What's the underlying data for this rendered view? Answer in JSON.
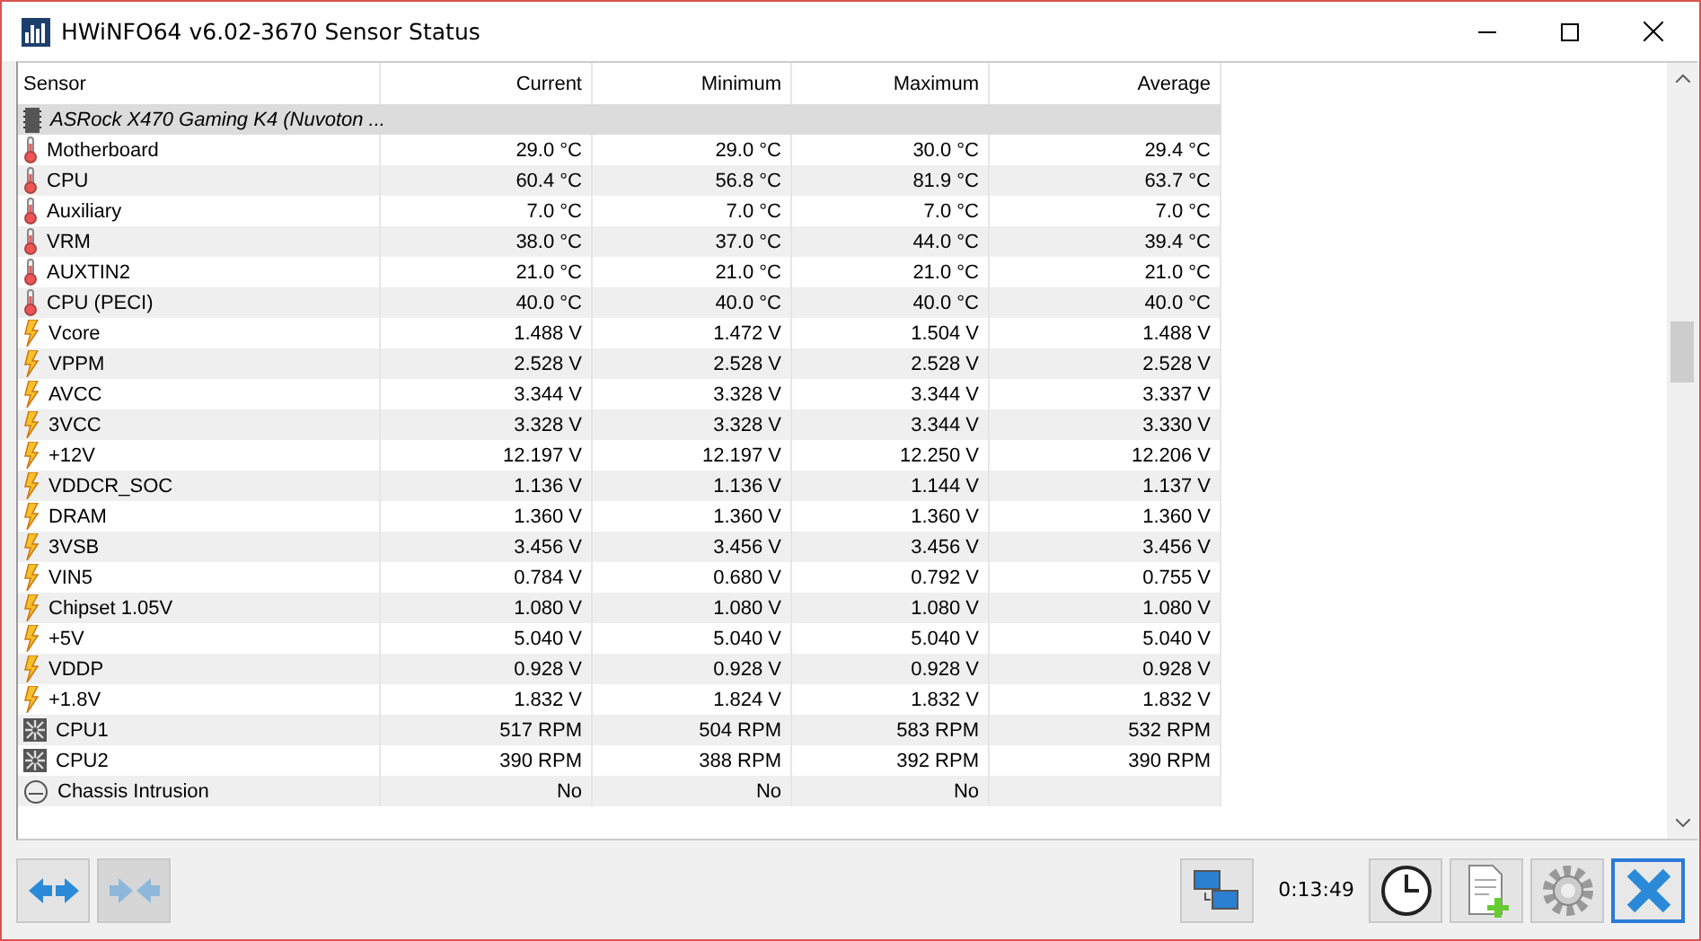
{
  "window": {
    "title": "HWiNFO64 v6.02-3670 Sensor Status"
  },
  "table": {
    "columns": [
      "Sensor",
      "Current",
      "Minimum",
      "Maximum",
      "Average"
    ],
    "rows": [
      {
        "kind": "group",
        "name": "ASRock X470 Gaming K4 (Nuvoton ...",
        "values": []
      },
      {
        "kind": "temperature",
        "name": "Motherboard",
        "values": [
          "29.0 °C",
          "29.0 °C",
          "30.0 °C",
          "29.4 °C"
        ]
      },
      {
        "kind": "temperature",
        "name": "CPU",
        "values": [
          "60.4 °C",
          "56.8 °C",
          "81.9 °C",
          "63.7 °C"
        ]
      },
      {
        "kind": "temperature",
        "name": "Auxiliary",
        "values": [
          "7.0 °C",
          "7.0 °C",
          "7.0 °C",
          "7.0 °C"
        ]
      },
      {
        "kind": "temperature",
        "name": "VRM",
        "values": [
          "38.0 °C",
          "37.0 °C",
          "44.0 °C",
          "39.4 °C"
        ]
      },
      {
        "kind": "temperature",
        "name": "AUXTIN2",
        "values": [
          "21.0 °C",
          "21.0 °C",
          "21.0 °C",
          "21.0 °C"
        ]
      },
      {
        "kind": "temperature",
        "name": "CPU (PECI)",
        "values": [
          "40.0 °C",
          "40.0 °C",
          "40.0 °C",
          "40.0 °C"
        ]
      },
      {
        "kind": "voltage",
        "name": "Vcore",
        "values": [
          "1.488 V",
          "1.472 V",
          "1.504 V",
          "1.488 V"
        ]
      },
      {
        "kind": "voltage",
        "name": "VPPM",
        "values": [
          "2.528 V",
          "2.528 V",
          "2.528 V",
          "2.528 V"
        ]
      },
      {
        "kind": "voltage",
        "name": "AVCC",
        "values": [
          "3.344 V",
          "3.328 V",
          "3.344 V",
          "3.337 V"
        ]
      },
      {
        "kind": "voltage",
        "name": "3VCC",
        "values": [
          "3.328 V",
          "3.328 V",
          "3.344 V",
          "3.330 V"
        ]
      },
      {
        "kind": "voltage",
        "name": "+12V",
        "values": [
          "12.197 V",
          "12.197 V",
          "12.250 V",
          "12.206 V"
        ]
      },
      {
        "kind": "voltage",
        "name": "VDDCR_SOC",
        "values": [
          "1.136 V",
          "1.136 V",
          "1.144 V",
          "1.137 V"
        ]
      },
      {
        "kind": "voltage",
        "name": "DRAM",
        "values": [
          "1.360 V",
          "1.360 V",
          "1.360 V",
          "1.360 V"
        ]
      },
      {
        "kind": "voltage",
        "name": "3VSB",
        "values": [
          "3.456 V",
          "3.456 V",
          "3.456 V",
          "3.456 V"
        ]
      },
      {
        "kind": "voltage",
        "name": "VIN5",
        "values": [
          "0.784 V",
          "0.680 V",
          "0.792 V",
          "0.755 V"
        ]
      },
      {
        "kind": "voltage",
        "name": "Chipset 1.05V",
        "values": [
          "1.080 V",
          "1.080 V",
          "1.080 V",
          "1.080 V"
        ]
      },
      {
        "kind": "voltage",
        "name": "+5V",
        "values": [
          "5.040 V",
          "5.040 V",
          "5.040 V",
          "5.040 V"
        ]
      },
      {
        "kind": "voltage",
        "name": "VDDP",
        "values": [
          "0.928 V",
          "0.928 V",
          "0.928 V",
          "0.928 V"
        ]
      },
      {
        "kind": "voltage",
        "name": "+1.8V",
        "values": [
          "1.832 V",
          "1.824 V",
          "1.832 V",
          "1.832 V"
        ]
      },
      {
        "kind": "fan",
        "name": "CPU1",
        "values": [
          "517 RPM",
          "504 RPM",
          "583 RPM",
          "532 RPM"
        ]
      },
      {
        "kind": "fan",
        "name": "CPU2",
        "values": [
          "390 RPM",
          "388 RPM",
          "392 RPM",
          "390 RPM"
        ]
      },
      {
        "kind": "intrusion",
        "name": "Chassis Intrusion",
        "values": [
          "No",
          "No",
          "No"
        ]
      }
    ]
  },
  "toolbar": {
    "timer": "0:13:49"
  }
}
